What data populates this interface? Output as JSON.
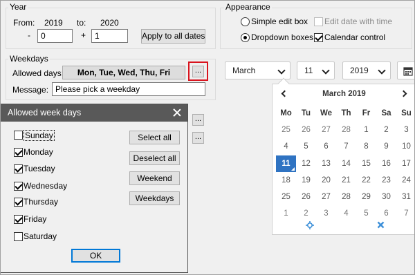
{
  "year": {
    "title": "Year",
    "from_label": "From:",
    "from_value": "2019",
    "to_label": "to:",
    "to_value": "2020",
    "minus": "-",
    "plus": "+",
    "minus_value": "0",
    "plus_value": "1",
    "apply_button": "Apply to all dates"
  },
  "weekdays": {
    "title": "Weekdays",
    "allowed_label": "Allowed days:",
    "allowed_value": "Mon, Tue, Wed, Thu, Fri",
    "dots_button": "...",
    "message_label": "Message:",
    "message_value": "Please pick a weekday",
    "extra_dots": "..."
  },
  "appearance": {
    "title": "Appearance",
    "simple_edit_box": "Simple edit box",
    "dropdown_boxes": "Dropdown boxes",
    "edit_date_with_time": "Edit date with time",
    "calendar_control": "Calendar control",
    "selected_mode": "Dropdown boxes"
  },
  "date_picker": {
    "month": "March",
    "day": "11",
    "year": "2019"
  },
  "calendar": {
    "header": "March 2019",
    "dow": [
      "Mo",
      "Tu",
      "We",
      "Th",
      "Fr",
      "Sa",
      "Su"
    ],
    "weeks": [
      [
        "25",
        "26",
        "27",
        "28",
        "1",
        "2",
        "3"
      ],
      [
        "4",
        "5",
        "6",
        "7",
        "8",
        "9",
        "10"
      ],
      [
        "11",
        "12",
        "13",
        "14",
        "15",
        "16",
        "17"
      ],
      [
        "18",
        "19",
        "20",
        "21",
        "22",
        "23",
        "24"
      ],
      [
        "25",
        "26",
        "27",
        "28",
        "29",
        "30",
        "31"
      ],
      [
        "1",
        "2",
        "3",
        "4",
        "5",
        "6",
        "7"
      ]
    ],
    "selected_day": "11",
    "accent": "#2f73c2",
    "footer_icons": [
      "crosshair-icon",
      "close-icon"
    ]
  },
  "dialog": {
    "title": "Allowed week days",
    "days": [
      {
        "label": "Sunday",
        "checked": false
      },
      {
        "label": "Monday",
        "checked": true
      },
      {
        "label": "Tuesday",
        "checked": true
      },
      {
        "label": "Wednesday",
        "checked": true
      },
      {
        "label": "Thursday",
        "checked": true
      },
      {
        "label": "Friday",
        "checked": true
      },
      {
        "label": "Saturday",
        "checked": false
      }
    ],
    "buttons": [
      "Select all",
      "Deselect all",
      "Weekend",
      "Weekdays"
    ],
    "ok": "OK"
  }
}
